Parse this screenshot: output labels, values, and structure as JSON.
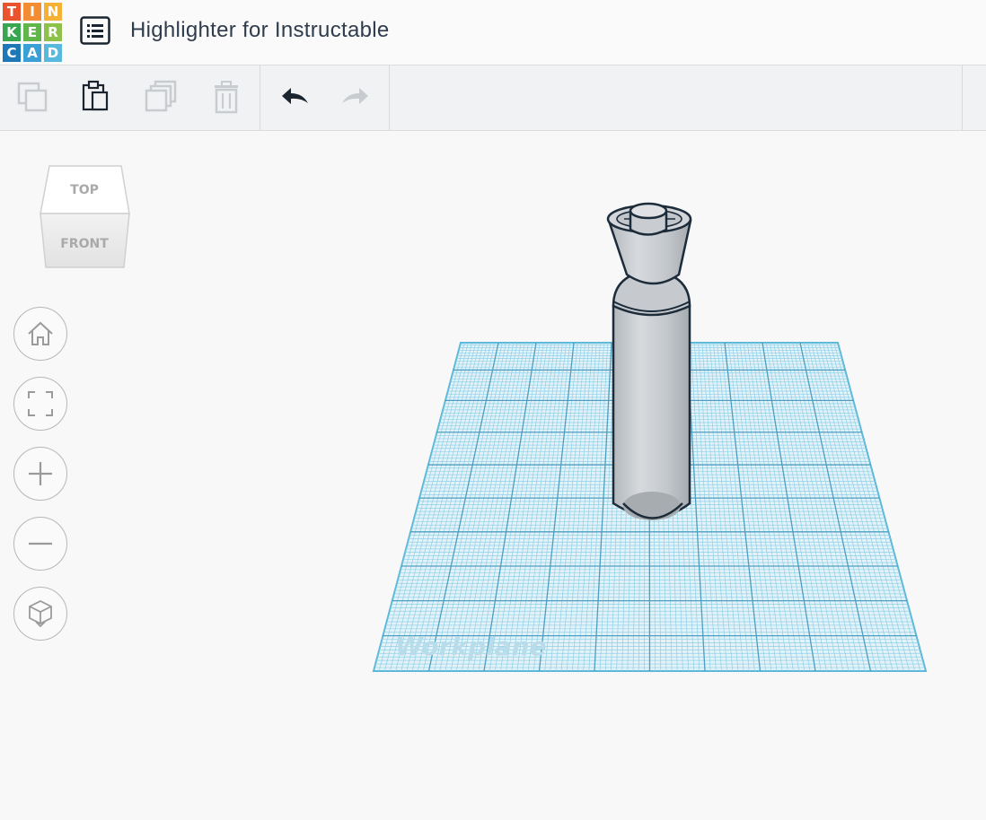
{
  "app": {
    "logo_letters": [
      "T",
      "I",
      "N",
      "K",
      "E",
      "R",
      "C",
      "A",
      "D"
    ],
    "logo_colors": [
      "#e9542f",
      "#f28d33",
      "#f5b136",
      "#37a64f",
      "#60b64a",
      "#8cc24a",
      "#1e78b7",
      "#3aa0d6",
      "#57b9dd"
    ]
  },
  "header": {
    "title": "Highlighter for Instructable",
    "menu_icon": "list-icon"
  },
  "toolbar": {
    "tools": [
      {
        "name": "copy",
        "icon": "copy-icon",
        "enabled": false
      },
      {
        "name": "paste",
        "icon": "paste-icon",
        "enabled": true
      },
      {
        "name": "duplicate",
        "icon": "duplicate-icon",
        "enabled": false
      },
      {
        "name": "delete",
        "icon": "trash-icon",
        "enabled": false
      },
      {
        "name": "undo",
        "icon": "undo-icon",
        "enabled": true
      },
      {
        "name": "redo",
        "icon": "redo-icon",
        "enabled": false
      }
    ]
  },
  "viewcube": {
    "top_label": "TOP",
    "front_label": "FRONT"
  },
  "nav": [
    "home-icon",
    "fit-view-icon",
    "zoom-in-icon",
    "zoom-out-icon",
    "perspective-icon"
  ],
  "workplane": {
    "label": "Workplane",
    "grid_color": "#5bb8d8"
  },
  "model": {
    "name": "highlighter",
    "color": "#c9cdd1"
  }
}
